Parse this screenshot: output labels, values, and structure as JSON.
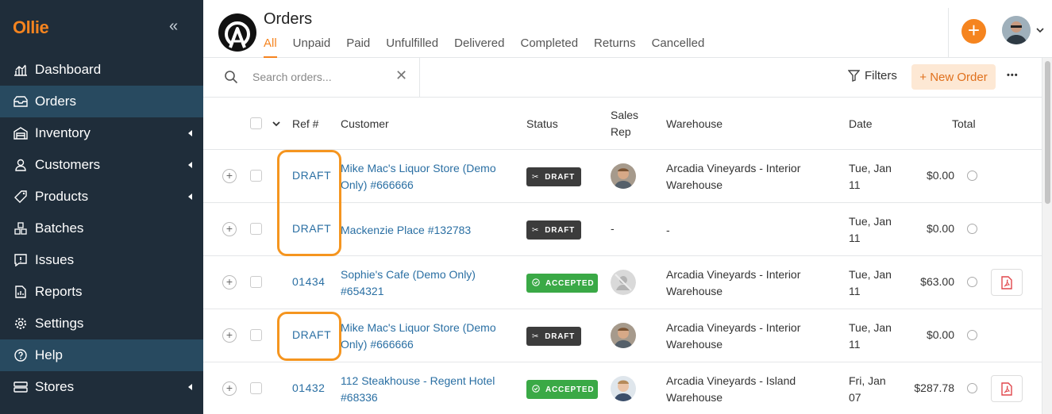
{
  "sidebar": {
    "logo": "Ollie",
    "collapse_glyph": "«",
    "items": [
      {
        "label": "Dashboard",
        "icon": "dashboard-icon"
      },
      {
        "label": "Orders",
        "icon": "orders-icon"
      },
      {
        "label": "Inventory",
        "icon": "inventory-icon"
      },
      {
        "label": "Customers",
        "icon": "customers-icon"
      },
      {
        "label": "Products",
        "icon": "products-icon"
      },
      {
        "label": "Batches",
        "icon": "batches-icon"
      },
      {
        "label": "Issues",
        "icon": "issues-icon"
      },
      {
        "label": "Reports",
        "icon": "reports-icon"
      },
      {
        "label": "Settings",
        "icon": "settings-icon"
      },
      {
        "label": "Help",
        "icon": "help-icon"
      },
      {
        "label": "Stores",
        "icon": "stores-icon"
      }
    ]
  },
  "header": {
    "title": "Orders",
    "tabs": [
      "All",
      "Unpaid",
      "Paid",
      "Unfulfilled",
      "Delivered",
      "Completed",
      "Returns",
      "Cancelled"
    ],
    "add_glyph": "+"
  },
  "toolbar": {
    "search_placeholder": "Search orders...",
    "clear_glyph": "✕",
    "filters_label": "Filters",
    "new_order_label": "+ New Order",
    "more_glyph": "•••"
  },
  "table": {
    "columns": {
      "ref": "Ref #",
      "customer": "Customer",
      "status": "Status",
      "sales_rep_1": "Sales",
      "sales_rep_2": "Rep",
      "warehouse": "Warehouse",
      "date": "Date",
      "total": "Total"
    },
    "rows": [
      {
        "ref": "DRAFT",
        "customer_1": "Mike Mac's Liquor Store (Demo",
        "customer_2": "Only) #666666",
        "status": "DRAFT",
        "rep": "-",
        "warehouse_1": "Arcadia Vineyards - Interior",
        "warehouse_2": "Warehouse",
        "date_1": "Tue, Jan",
        "date_2": "11",
        "total": "$0.00"
      },
      {
        "ref": "DRAFT",
        "customer_1": "Mackenzie Place #132783",
        "customer_2": "",
        "status": "DRAFT",
        "rep": "-",
        "warehouse_1": "-",
        "warehouse_2": "",
        "date_1": "Tue, Jan",
        "date_2": "11",
        "total": "$0.00"
      },
      {
        "ref": "01434",
        "customer_1": "Sophie's Cafe (Demo Only)",
        "customer_2": "#654321",
        "status": "ACCEPTED",
        "rep": "-",
        "warehouse_1": "Arcadia Vineyards - Interior",
        "warehouse_2": "Warehouse",
        "date_1": "Tue, Jan",
        "date_2": "11",
        "total": "$63.00"
      },
      {
        "ref": "DRAFT",
        "customer_1": "Mike Mac's Liquor Store (Demo",
        "customer_2": "Only) #666666",
        "status": "DRAFT",
        "rep": "-",
        "warehouse_1": "Arcadia Vineyards - Interior",
        "warehouse_2": "Warehouse",
        "date_1": "Tue, Jan",
        "date_2": "11",
        "total": "$0.00"
      },
      {
        "ref": "01432",
        "customer_1": "112 Steakhouse - Regent Hotel",
        "customer_2": "#68336",
        "status": "ACCEPTED",
        "rep": "-",
        "warehouse_1": "Arcadia Vineyards - Island",
        "warehouse_2": "Warehouse",
        "date_1": "Fri, Jan",
        "date_2": "07",
        "total": "$287.78"
      }
    ]
  },
  "colors": {
    "accent": "#f5841f",
    "sidebar_bg": "#1f2d3a",
    "link": "#2a6fa3",
    "draft_badge": "#3c3c3c",
    "accepted_badge": "#3aa946"
  }
}
